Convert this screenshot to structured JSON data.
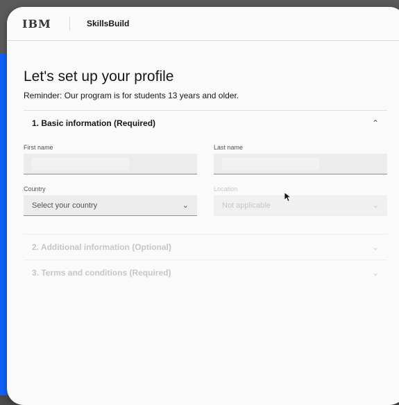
{
  "topbar": {
    "logo": "IBM",
    "brand": "SkillsBuild"
  },
  "page": {
    "title": "Let's set up your profile",
    "reminder": "Reminder: Our program is for students 13 years and older."
  },
  "sections": [
    {
      "title": "1. Basic information (Required)",
      "expanded": true,
      "chevron_icon": "chevron-up-icon"
    },
    {
      "title": "2. Additional information (Optional)",
      "expanded": false,
      "chevron_icon": "chevron-down-icon"
    },
    {
      "title": "3. Terms and conditions (Required)",
      "expanded": false,
      "chevron_icon": "chevron-down-icon"
    }
  ],
  "form": {
    "first_name": {
      "label": "First name",
      "value": ""
    },
    "last_name": {
      "label": "Last name",
      "value": ""
    },
    "country": {
      "label": "Country",
      "value": "Select your country"
    },
    "location": {
      "label": "Location",
      "value": "Not applicable",
      "disabled": true
    }
  },
  "colors": {
    "accent": "#0f62fe",
    "window_bg": "#fafafa",
    "field_bg": "#ececec"
  }
}
